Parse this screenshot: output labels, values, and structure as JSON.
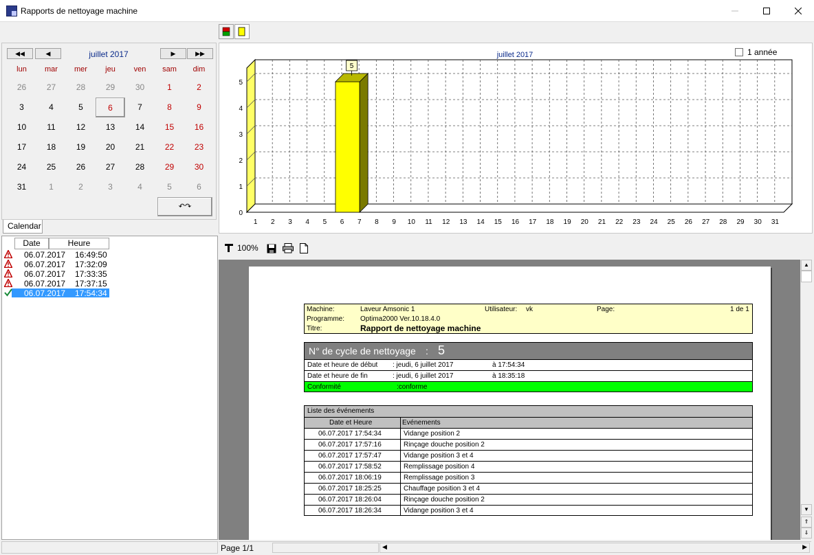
{
  "window": {
    "title": "Rapports de nettoyage machine"
  },
  "calendar": {
    "month_label": "juillet 2017",
    "nav": [
      "◀◀",
      "◀",
      "▶",
      "▶▶"
    ],
    "weekdays": [
      "lun",
      "mar",
      "mer",
      "jeu",
      "ven",
      "sam",
      "dim"
    ],
    "weeks": [
      [
        "26",
        "27",
        "28",
        "29",
        "30",
        "1",
        "2"
      ],
      [
        "3",
        "4",
        "5",
        "6",
        "7",
        "8",
        "9"
      ],
      [
        "10",
        "11",
        "12",
        "13",
        "14",
        "15",
        "16"
      ],
      [
        "17",
        "18",
        "19",
        "20",
        "21",
        "22",
        "23"
      ],
      [
        "24",
        "25",
        "26",
        "27",
        "28",
        "29",
        "30"
      ],
      [
        "31",
        "1",
        "2",
        "3",
        "4",
        "5",
        "6"
      ]
    ],
    "tab_label": "Calendar"
  },
  "chart_data": {
    "type": "bar",
    "title": "juillet 2017",
    "checkbox_label": "1 année",
    "categories": [
      "1",
      "2",
      "3",
      "4",
      "5",
      "6",
      "7",
      "8",
      "9",
      "10",
      "11",
      "12",
      "13",
      "14",
      "15",
      "16",
      "17",
      "18",
      "19",
      "20",
      "21",
      "22",
      "23",
      "24",
      "25",
      "26",
      "27",
      "28",
      "29",
      "30",
      "31"
    ],
    "values": [
      0,
      0,
      0,
      0,
      0,
      5,
      0,
      0,
      0,
      0,
      0,
      0,
      0,
      0,
      0,
      0,
      0,
      0,
      0,
      0,
      0,
      0,
      0,
      0,
      0,
      0,
      0,
      0,
      0,
      0,
      0
    ],
    "data_labels": {
      "6": "5"
    },
    "y_ticks": [
      "0",
      "1",
      "2",
      "3",
      "4",
      "5"
    ],
    "ylim": [
      0,
      5
    ],
    "bar_color": "#ffff00",
    "grid": true
  },
  "list": {
    "headers": {
      "date": "Date",
      "time": "Heure"
    },
    "rows": [
      {
        "status": "warning-icon",
        "date": "06.07.2017",
        "time": "16:49:50"
      },
      {
        "status": "warning-icon",
        "date": "06.07.2017",
        "time": "17:32:09"
      },
      {
        "status": "warning-icon",
        "date": "06.07.2017",
        "time": "17:33:35"
      },
      {
        "status": "warning-icon",
        "date": "06.07.2017",
        "time": "17:37:15"
      },
      {
        "status": "check-icon",
        "date": "06.07.2017",
        "time": "17:54:34",
        "selected": true
      }
    ]
  },
  "report_toolbar": {
    "zoom": "100%"
  },
  "report": {
    "machine_label": "Machine:",
    "machine": "Laveur Amsonic 1",
    "user_label": "Utilisateur:",
    "user": "vk",
    "page_label": "Page:",
    "page": "1 de 1",
    "program_label": "Programme:",
    "program": "Optima2000 Ver.10.18.4.0",
    "title_label": "Titre:",
    "title": "Rapport de nettoyage machine",
    "cycle_label": "N° de cycle de nettoyage",
    "cycle_sep": ":",
    "cycle_no": "5",
    "start_label": "Date et heure de début",
    "start_date": ": jeudi, 6 juillet 2017",
    "start_time": "à 17:54:34",
    "end_label": "Date et heure de fin",
    "end_date": ": jeudi, 6 juillet 2017",
    "end_time": "à 18:35:18",
    "conformity_label": "Conformité",
    "conformity": ":conforme",
    "events_title": "Liste des événements",
    "events_headers": {
      "datetime": "Date et Heure",
      "event": "Evénements"
    },
    "events": [
      {
        "datetime": "06.07.2017 17:54:34",
        "event": "Vidange position 2"
      },
      {
        "datetime": "06.07.2017 17:57:16",
        "event": "Rinçage douche position 2"
      },
      {
        "datetime": "06.07.2017 17:57:47",
        "event": "Vidange position 3 et 4"
      },
      {
        "datetime": "06.07.2017 17:58:52",
        "event": "Remplissage position 4"
      },
      {
        "datetime": "06.07.2017 18:06:19",
        "event": "Remplissage position 3"
      },
      {
        "datetime": "06.07.2017 18:25:25",
        "event": "Chauffage position 3 et 4"
      },
      {
        "datetime": "06.07.2017 18:26:04",
        "event": "Rinçage douche position 2"
      },
      {
        "datetime": "06.07.2017 18:26:34",
        "event": "Vidange position 3 et 4"
      }
    ]
  },
  "status": {
    "page": "Page 1/1"
  },
  "colors": {
    "conform_green": "#00ff00",
    "header_yellow": "#ffffc8",
    "selection_blue": "#3399ff"
  }
}
